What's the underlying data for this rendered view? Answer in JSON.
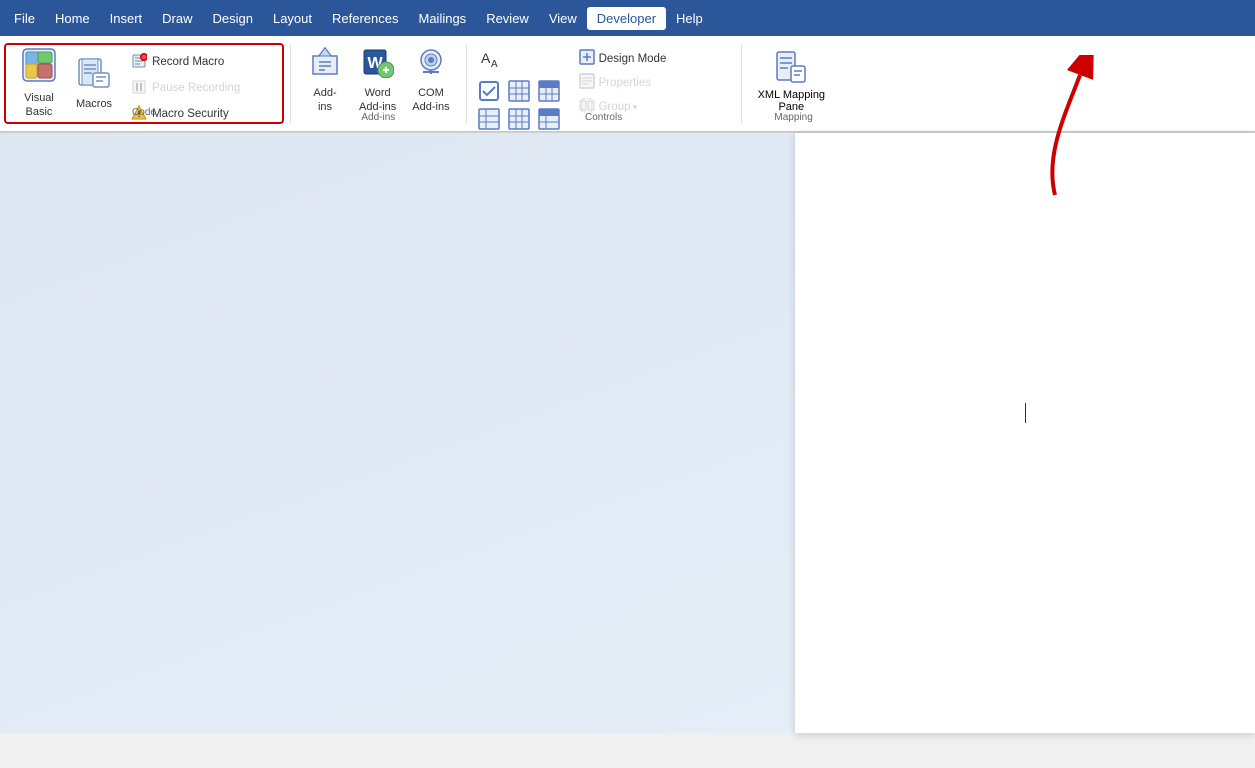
{
  "menu": {
    "items": [
      {
        "label": "File",
        "active": false
      },
      {
        "label": "Home",
        "active": false
      },
      {
        "label": "Insert",
        "active": false
      },
      {
        "label": "Draw",
        "active": false
      },
      {
        "label": "Design",
        "active": false
      },
      {
        "label": "Layout",
        "active": false
      },
      {
        "label": "References",
        "active": false
      },
      {
        "label": "Mailings",
        "active": false
      },
      {
        "label": "Review",
        "active": false
      },
      {
        "label": "View",
        "active": false
      },
      {
        "label": "Developer",
        "active": true
      },
      {
        "label": "Help",
        "active": false
      }
    ]
  },
  "ribbon": {
    "groups": {
      "code": {
        "label": "Code",
        "visual_basic_label": "Visual\nBasic",
        "macros_label": "Macros",
        "record_macro_label": "Record Macro",
        "pause_recording_label": "Pause Recording",
        "macro_security_label": "Macro Security"
      },
      "addins": {
        "label": "Add-ins",
        "add_ins_label": "Add-\nins",
        "word_add_ins_label": "Word\nAdd-ins",
        "com_add_ins_label": "COM\nAdd-ins"
      },
      "controls": {
        "label": "Controls",
        "design_mode_label": "Design Mode",
        "properties_label": "Properties",
        "group_label": "Group"
      },
      "mapping": {
        "label": "Mapping",
        "xml_mapping_label": "XML Mapping\nPane"
      }
    }
  },
  "document": {
    "cursor_visible": true
  },
  "annotation": {
    "arrow_color": "#cc0000"
  }
}
